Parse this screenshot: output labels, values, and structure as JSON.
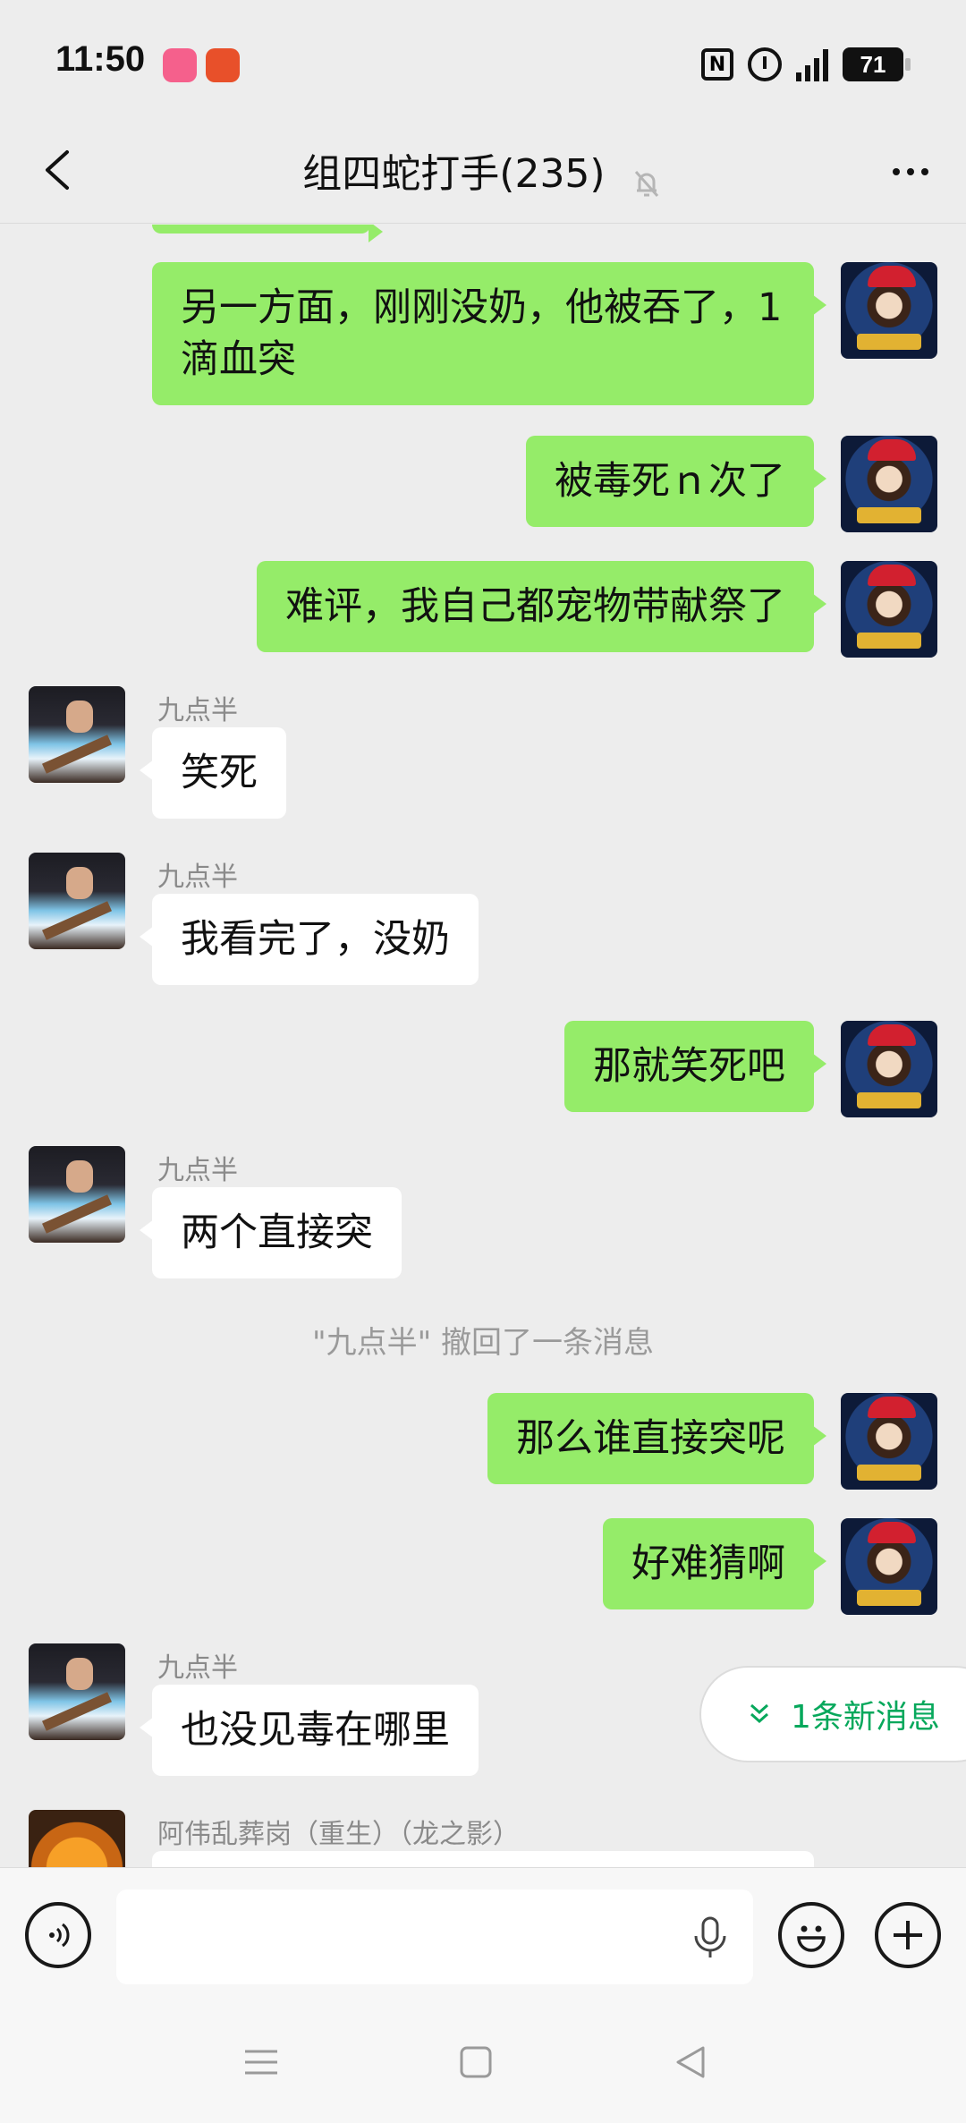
{
  "status_bar": {
    "time": "11:50",
    "network": "5G",
    "battery": "71"
  },
  "header": {
    "title": "组四蛇打手(235)"
  },
  "messages": [
    {
      "from": "self",
      "text": "另一方面，刚刚没奶，他被吞了，1滴血突"
    },
    {
      "from": "self",
      "text": "被毒死ｎ次了"
    },
    {
      "from": "self",
      "text": "难评，我自己都宠物带献祭了"
    },
    {
      "from": "peer",
      "sender": "九点半",
      "text": "笑死"
    },
    {
      "from": "peer",
      "sender": "九点半",
      "text": "我看完了，没奶"
    },
    {
      "from": "self",
      "text": "那就笑死吧"
    },
    {
      "from": "peer",
      "sender": "九点半",
      "text": "两个直接突"
    },
    {
      "from": "system",
      "text": "\"九点半\" 撤回了一条消息"
    },
    {
      "from": "self",
      "text": "那么谁直接突呢"
    },
    {
      "from": "self",
      "text": "好难猜啊"
    },
    {
      "from": "peer",
      "sender": "九点半",
      "text": "也没见毒在哪里"
    },
    {
      "from": "peer",
      "sender": "阿伟乱葬岗（重生）（龙之影）",
      "text": ""
    }
  ],
  "new_messages": {
    "label": "1条新消息"
  },
  "input": {
    "value": "",
    "placeholder": ""
  },
  "colors": {
    "self_bubble": "#95ec69",
    "peer_bubble": "#ffffff",
    "background": "#ededed",
    "new_msg_accent": "#07a85c"
  }
}
